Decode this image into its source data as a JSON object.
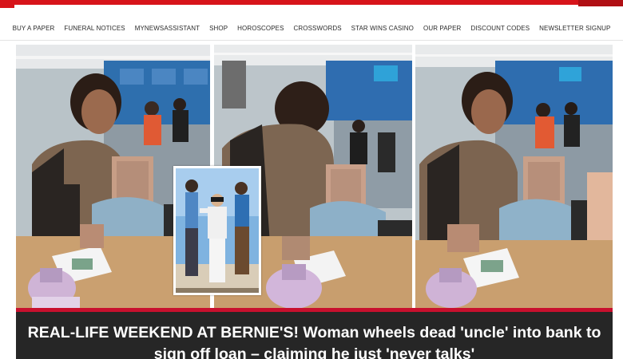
{
  "site": {
    "nav_items": [
      "BUY A PAPER",
      "FUNERAL NOTICES",
      "MYNEWSASSISTANT",
      "SHOP",
      "HOROSCOPES",
      "CROSSWORDS",
      "STAR WINS CASINO",
      "OUR PAPER",
      "DISCOUNT CODES",
      "NEWSLETTER SIGNUP"
    ],
    "brand_color": "#d7141a"
  },
  "article": {
    "headline": "REAL-LIFE WEEKEND AT BERNIE'S! Woman wheels dead 'uncle' into bank to sign off loan – claiming he just 'never talks'",
    "headline_bg": "#262626",
    "accent_border": "#c8102e"
  },
  "images": {
    "panels": [
      "bank-scene-photo-1",
      "bank-scene-photo-2",
      "bank-scene-photo-3"
    ],
    "inset": "movie-poster-inset"
  }
}
